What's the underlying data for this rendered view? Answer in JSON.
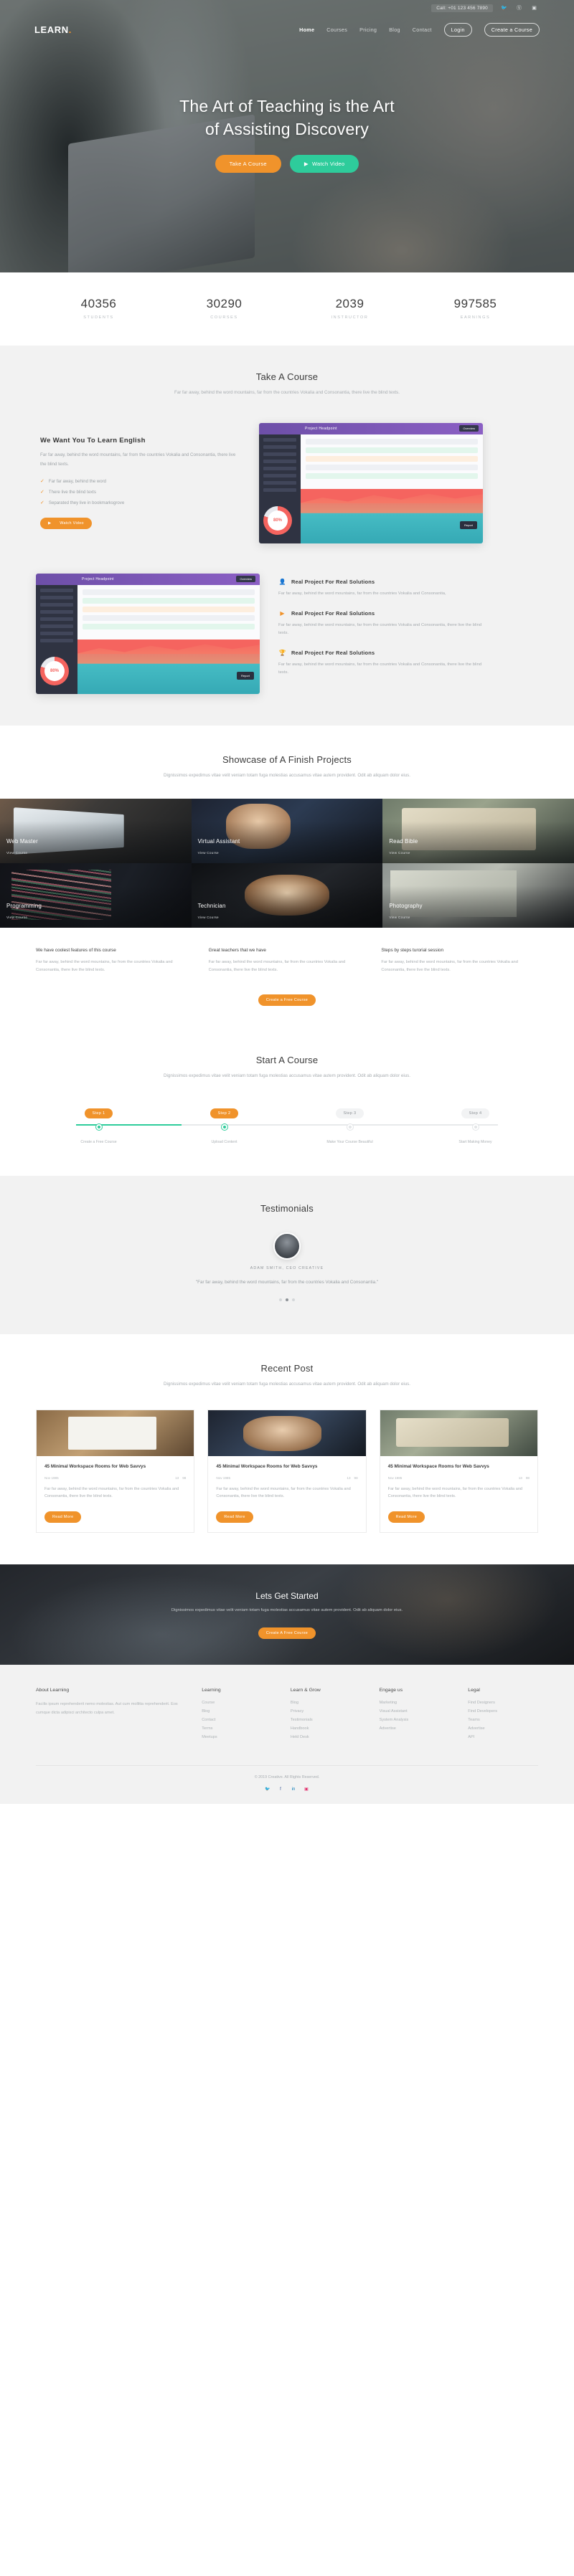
{
  "topbar": {
    "call": "Call: +01 123 456 7890",
    "social": [
      "twitter-icon",
      "pinterest-icon",
      "instagram-icon"
    ]
  },
  "brand": {
    "name": "LEARN",
    "dot": "."
  },
  "nav": {
    "items": [
      {
        "label": "Home",
        "active": true
      },
      {
        "label": "Courses",
        "active": false
      },
      {
        "label": "Pricing",
        "active": false
      },
      {
        "label": "Blog",
        "active": false
      },
      {
        "label": "Contact",
        "active": false
      }
    ],
    "login": "Login",
    "create": "Create a Course"
  },
  "hero": {
    "line1": "The Art of Teaching is the Art",
    "line2": "of Assisting Discovery",
    "btn_primary": "Take A Course",
    "btn_secondary": "Watch Video"
  },
  "stats": [
    {
      "num": "40356",
      "label": "STUDENTS"
    },
    {
      "num": "30290",
      "label": "COURSES"
    },
    {
      "num": "2039",
      "label": "INSTRUCTOR"
    },
    {
      "num": "997585",
      "label": "EARNINGS"
    }
  ],
  "take_course": {
    "title": "Take A Course",
    "subtitle": "Far far away, behind the word mountains, far from the countries Vokalia and Consonantia, there live the blind texts.",
    "heading": "We Want You To Learn English",
    "lead": "Far far away, behind the word mountains, far from the countries Vokalia and Consonantia, there live the blind texts.",
    "checks": [
      "Far far away, behind the word",
      "There live the blind texts",
      "Separated they live in bookmarksgrove"
    ],
    "watch_btn": "Watch Video",
    "dashboard": {
      "title": "Project Headpoint",
      "badge": "80%",
      "note": "Report",
      "button": "Overview"
    }
  },
  "features": [
    {
      "icon": "user-icon",
      "title": "Real Project For Real Solutions",
      "text": "Far far away, behind the word mountains, far from the countries Vokalia and Consonantia,"
    },
    {
      "icon": "video-icon",
      "title": "Real Project For Real Solutions",
      "text": "Far far away, behind the word mountains, far from the countries Vokalia and Consonantia, there live the blind texts."
    },
    {
      "icon": "trophy-icon",
      "title": "Real Project For Real Solutions",
      "text": "Far far away, behind the word mountains, far from the countries Vokalia and Consonantia, there live the blind texts."
    }
  ],
  "showcase": {
    "title": "Showcase of A Finish Projects",
    "subtitle": "Dignissimos expedimus vitae velit veniam totam fuga molestias accusamus vitae autem provident. Odit ab aliquam dolor eius.",
    "projects": [
      {
        "name": "Web Master",
        "action": "View Course"
      },
      {
        "name": "Virtual Assistant",
        "action": "View Course"
      },
      {
        "name": "Read Bible",
        "action": "View Course"
      },
      {
        "name": "Programming",
        "action": "View Course"
      },
      {
        "name": "Technician",
        "action": "View Course"
      },
      {
        "name": "Photography",
        "action": "View Course"
      }
    ],
    "columns": [
      {
        "title": "We have coolest features of this course",
        "text": "Far far away, behind the word mountains, far from the countries Vokalia and Consonantia, there live the blind texts."
      },
      {
        "title": "Great teachers that we have",
        "text": "Far far away, behind the word mountains, far from the countries Vokalia and Consonantia, there live the blind texts."
      },
      {
        "title": "Steps by steps turorial session",
        "text": "Far far away, behind the word mountains, far from the countries Vokalia and Consonantia, there live the blind texts."
      }
    ],
    "cta_btn": "Create a Free Course"
  },
  "start_course": {
    "title": "Start A Course",
    "subtitle": "Dignissimos expedimus vitae velit veniam totam fuga molestias accusamus vitae autem provident. Odit ab aliquam dolor eius.",
    "steps": [
      {
        "pill": "Step 1",
        "caption": "Create a Free Course",
        "done": true
      },
      {
        "pill": "Step 2",
        "caption": "Upload Content",
        "done": true
      },
      {
        "pill": "Step 3",
        "caption": "Make Your Course Beautiful",
        "done": false
      },
      {
        "pill": "Step 4",
        "caption": "Start Making Money",
        "done": false
      }
    ]
  },
  "testimonials": {
    "title": "Testimonials",
    "author": "ADAM SMITH, CEO CREATIVE",
    "quote": "\"Far far away, behind the word mountains, far from the countries Vokalia and Consonantia.\"",
    "dots": 3,
    "active_dot": 1
  },
  "recent": {
    "title": "Recent Post",
    "subtitle": "Dignissimos expedimus vitae velit veniam totam fuga molestias accusamus vitae autem provident. Odit ab aliquam dolor eius.",
    "posts": [
      {
        "title": "45 Minimal Workspace Rooms for Web Savvys",
        "date": "Nov 1985",
        "comments": "13",
        "likes": "98",
        "text": "Far far away, behind the word mountains, far from the countries Vokalia and Consonantia, there live the blind texts.",
        "btn": "Read More"
      },
      {
        "title": "45 Minimal Workspace Rooms for Web Savvys",
        "date": "Nov 1985",
        "comments": "13",
        "likes": "98",
        "text": "Far far away, behind the word mountains, far from the countries Vokalia and Consonantia, there live the blind texts.",
        "btn": "Read More"
      },
      {
        "title": "45 Minimal Workspace Rooms for Web Savvys",
        "date": "Nov 1985",
        "comments": "13",
        "likes": "98",
        "text": "Far far away, behind the word mountains, far from the countries Vokalia and Consonantia, there live the blind texts.",
        "btn": "Read More"
      }
    ]
  },
  "cta": {
    "title": "Lets Get Started",
    "subtitle": "Dignissimos expedimus vitae velit veniam totam fuga molestias accusamus vitae autem provident. Odit ab aliquam dolor eius.",
    "btn": "Create A Free Course"
  },
  "footer": {
    "about": {
      "title": "About Learning",
      "text": "Facilis ipsum reprehenderit nemo molestias. Aut cum mollitia reprehenderit. Eos cumque dicta adipisci architecto culpa amet."
    },
    "columns": [
      {
        "title": "Learning",
        "items": [
          "Course",
          "Blog",
          "Contact",
          "Terms",
          "Meetups"
        ]
      },
      {
        "title": "Learn & Grow",
        "items": [
          "Blog",
          "Privacy",
          "Testimonials",
          "Handbook",
          "Held Desk"
        ]
      },
      {
        "title": "Engage us",
        "items": [
          "Marketing",
          "Visual Assistant",
          "System Analysis",
          "Advertise"
        ]
      },
      {
        "title": "Legal",
        "items": [
          "Find Designers",
          "Find Developers",
          "Teams",
          "Advertise",
          "API"
        ]
      }
    ],
    "copyright": "© 2019 Creative. All Rights Reserved.",
    "social": [
      "twitter-icon",
      "facebook-icon",
      "linkedin-icon",
      "instagram-icon"
    ]
  },
  "colors": {
    "orange": "#f0932b",
    "green": "#2ecc9b",
    "grey_bg": "#f2f2f2"
  }
}
